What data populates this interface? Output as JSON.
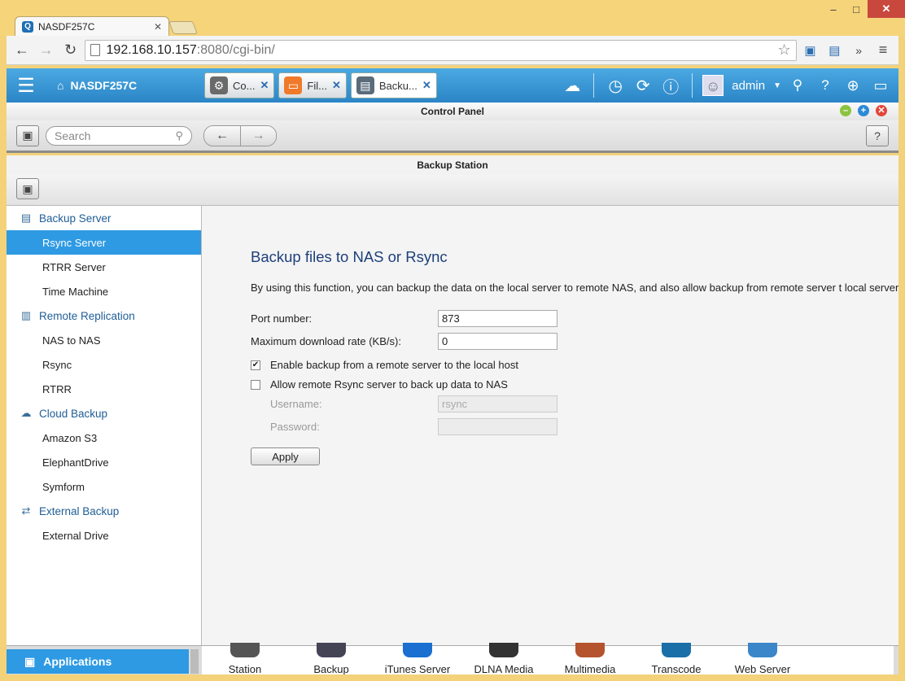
{
  "browser": {
    "tab_title": "NASDF257C",
    "tab_icon": "Q",
    "url_host": "192.168.10.157",
    "url_rest": ":8080/cgi-bin/",
    "controls": {
      "minimize": "–",
      "maximize": "□",
      "close": "✕"
    }
  },
  "topbar": {
    "menu_icon": "☰",
    "home_label": "NASDF257C",
    "tabs": [
      {
        "label": "Co...",
        "icon": "gear-icon",
        "color": "#6a6a6a"
      },
      {
        "label": "Fil...",
        "icon": "folder-icon",
        "color": "#f07a2a"
      },
      {
        "label": "Backu...",
        "icon": "backup-icon",
        "color": "#5a6b7a"
      }
    ],
    "user": "admin"
  },
  "control_panel": {
    "title": "Control Panel",
    "search_placeholder": "Search",
    "help": "?"
  },
  "backup_station": {
    "title": "Backup Station"
  },
  "sidebar": {
    "groups": [
      {
        "label": "Backup Server",
        "items": [
          "Rsync Server",
          "RTRR Server",
          "Time Machine"
        ]
      },
      {
        "label": "Remote Replication",
        "items": [
          "NAS to NAS",
          "Rsync",
          "RTRR"
        ]
      },
      {
        "label": "Cloud Backup",
        "items": [
          "Amazon S3",
          "ElephantDrive",
          "Symform"
        ]
      },
      {
        "label": "External Backup",
        "items": [
          "External Drive"
        ]
      }
    ],
    "active": "Rsync Server"
  },
  "main": {
    "heading": "Backup files to NAS or Rsync",
    "description": "By using this function, you can backup the data on the local server to remote NAS, and also allow backup from remote server t local server.",
    "port_label": "Port number:",
    "port_value": "873",
    "rate_label": "Maximum download rate (KB/s):",
    "rate_value": "0",
    "enable_backup_label": "Enable backup from a remote server to the local host",
    "enable_backup_checked": true,
    "allow_rsync_label": "Allow remote Rsync server to back up data to NAS",
    "allow_rsync_checked": false,
    "username_label": "Username:",
    "username_placeholder": "rsync",
    "password_label": "Password:",
    "apply_label": "Apply"
  },
  "dock": {
    "applications_label": "Applications",
    "apps": [
      {
        "label": "Station",
        "color": "#555"
      },
      {
        "label": "Backup",
        "color": "#445"
      },
      {
        "label": "iTunes Server",
        "color": "#1a6fd0"
      },
      {
        "label": "DLNA Media",
        "color": "#333"
      },
      {
        "label": "Multimedia",
        "color": "#b5532e"
      },
      {
        "label": "Transcode",
        "color": "#1a6fa8"
      },
      {
        "label": "Web Server",
        "color": "#3a86c8"
      }
    ]
  },
  "colors": {
    "accent": "#2e9ae3",
    "topbar": "#3a97d6",
    "heading": "#1d3f7a"
  }
}
